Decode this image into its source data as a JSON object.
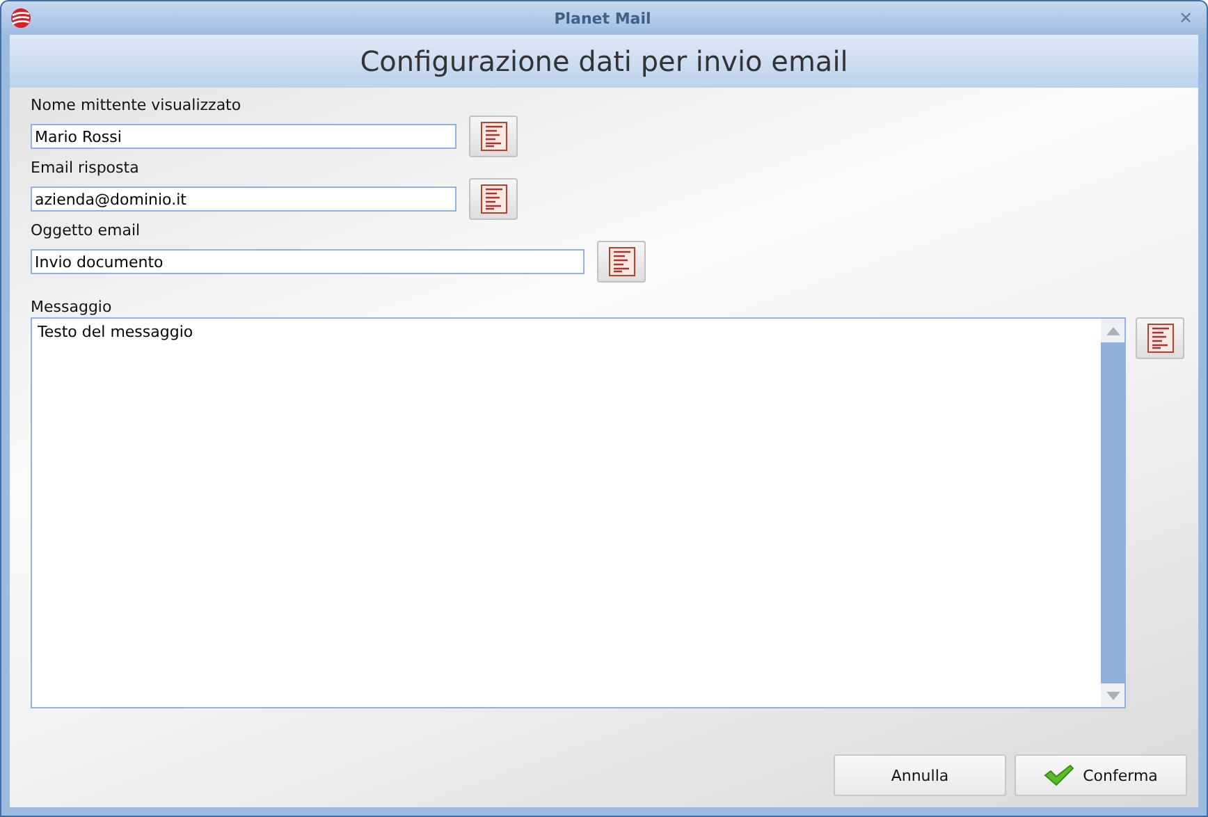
{
  "window": {
    "title": "Planet Mail",
    "close": "✕"
  },
  "header": "Configurazione dati per invio email",
  "fields": [
    {
      "label": "Nome mittente visualizzato",
      "value": "Mario Rossi",
      "kind": "short"
    },
    {
      "label": "Email risposta",
      "value": "azienda@dominio.it",
      "kind": "short"
    },
    {
      "label": "Oggetto email",
      "value": "Invio documento",
      "kind": "medium"
    }
  ],
  "message": {
    "label": "Messaggio",
    "value": "Testo del messaggio"
  },
  "buttons": [
    {
      "label": "Annulla",
      "kind": "plain"
    },
    {
      "label": "Conferma",
      "kind": "confirm"
    }
  ]
}
